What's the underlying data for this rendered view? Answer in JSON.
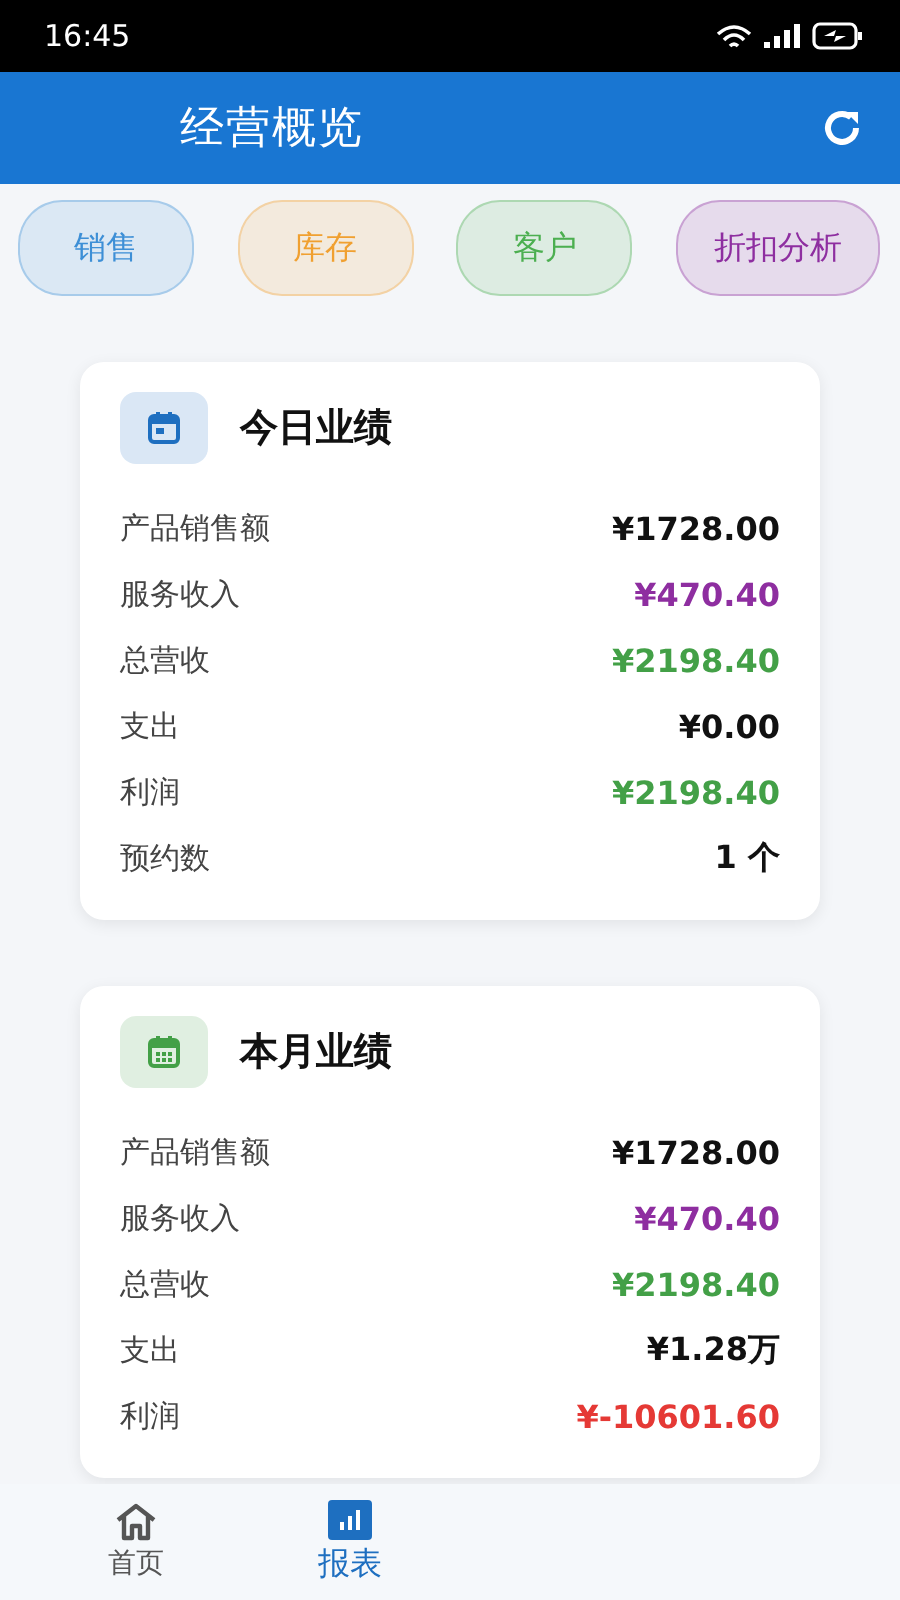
{
  "status_bar": {
    "time": "16:45"
  },
  "header": {
    "title": "经营概览"
  },
  "tabs": [
    {
      "label": "销售",
      "color": "#3d8fd6"
    },
    {
      "label": "库存",
      "color": "#f0a030"
    },
    {
      "label": "客户",
      "color": "#4caf50"
    },
    {
      "label": "折扣分析",
      "color": "#8e2ea0"
    }
  ],
  "cards": [
    {
      "title": "今日业绩",
      "kind": "day",
      "color": "#1e6fc0",
      "rows": [
        {
          "label": "产品销售额",
          "value": "¥1728.00",
          "color": "#111111"
        },
        {
          "label": "服务收入",
          "value": "¥470.40",
          "color": "#8e2ea0"
        },
        {
          "label": "总营收",
          "value": "¥2198.40",
          "color": "#43a047"
        },
        {
          "label": "支出",
          "value": "¥0.00",
          "color": "#111111"
        },
        {
          "label": "利润",
          "value": "¥2198.40",
          "color": "#43a047"
        },
        {
          "label": "预约数",
          "value": "1 个",
          "color": "#111111"
        }
      ]
    },
    {
      "title": "本月业绩",
      "kind": "month",
      "color": "#43a047",
      "rows": [
        {
          "label": "产品销售额",
          "value": "¥1728.00",
          "color": "#111111"
        },
        {
          "label": "服务收入",
          "value": "¥470.40",
          "color": "#8e2ea0"
        },
        {
          "label": "总营收",
          "value": "¥2198.40",
          "color": "#43a047"
        },
        {
          "label": "支出",
          "value": "¥1.28万",
          "color": "#111111"
        },
        {
          "label": "利润",
          "value": "¥-10601.60",
          "color": "#e53935"
        }
      ]
    }
  ],
  "bottom_nav": [
    {
      "label": "首页",
      "kind": "home",
      "selected": false
    },
    {
      "label": "报表",
      "kind": "report",
      "selected": true
    }
  ]
}
